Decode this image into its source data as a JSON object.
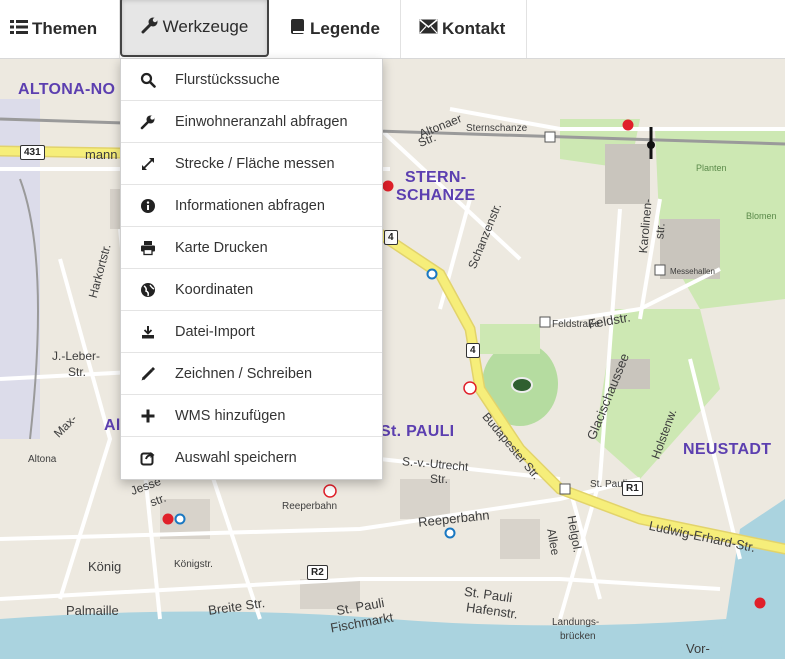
{
  "nav": {
    "themen": "Themen",
    "werkzeuge": "Werkzeuge",
    "legende": "Legende",
    "kontakt": "Kontakt"
  },
  "tools_menu": {
    "items": [
      {
        "label": "Flurstückssuche",
        "icon": "search-icon"
      },
      {
        "label": "Einwohneranzahl abfragen",
        "icon": "wrench-icon"
      },
      {
        "label": "Strecke / Fläche messen",
        "icon": "resize-icon"
      },
      {
        "label": "Informationen abfragen",
        "icon": "info-icon"
      },
      {
        "label": "Karte Drucken",
        "icon": "print-icon"
      },
      {
        "label": "Koordinaten",
        "icon": "globe-icon"
      },
      {
        "label": "Datei-Import",
        "icon": "import-icon"
      },
      {
        "label": "Zeichnen / Schreiben",
        "icon": "pencil-icon"
      },
      {
        "label": "WMS hinzufügen",
        "icon": "plus-icon"
      },
      {
        "label": "Auswahl speichern",
        "icon": "share-icon"
      }
    ]
  },
  "map": {
    "districts": [
      "ALTONA-NO",
      "STERN-",
      "SCHANZE",
      "St. PAULI",
      "NEUSTADT",
      "Al"
    ],
    "streets": [
      "mann",
      "Harkortstr.",
      "J.-Leber-",
      "Str.",
      "Max-",
      "Altonaer",
      "Str.",
      "Sternschanze",
      "Schanzenstr.",
      "Feldstr.",
      "Feldstraße",
      "Karolinen-",
      "str.",
      "Budapester Str.",
      "Glacischaussee",
      "Holstenw.",
      "S.-v.-Utrecht",
      "Str.",
      "Reeperbahn",
      "Reeperbahn",
      "Ludwig-Erhard-Str.",
      "Helgol.",
      "Allee",
      "Jesse",
      "str.",
      "König",
      "Königstr.",
      "Breite Str.",
      "Palmaille",
      "St. Pauli",
      "Fischmarkt",
      "St. Pauli",
      "Hafenstr.",
      "Landungs-",
      "brücken",
      "St. Pauli",
      "Vor-",
      "Altona",
      "Planten",
      "Blomen",
      "Messehallen"
    ],
    "shields": [
      "431",
      "4",
      "4",
      "R2",
      "R1"
    ],
    "colors": {
      "land": "#ede9e0",
      "water": "#aad3df",
      "park": "#cde8b3",
      "major_road": "#f6ee7a",
      "district": "#5c3fb0"
    }
  }
}
